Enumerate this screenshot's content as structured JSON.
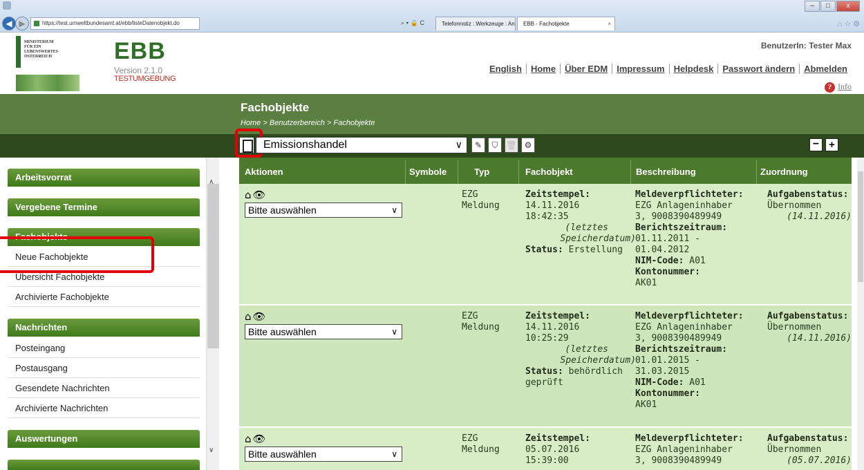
{
  "browser": {
    "url": "https://test.umweltbundesamt.at/ebb/listeDatenobjekt.do",
    "addr_tools": "⌕ ▾ 🔒 C",
    "tabs": [
      {
        "label": "Telefonnotiz : Werkzeuge : An..."
      },
      {
        "label": "EBB - Fachobjekte",
        "close": "×"
      }
    ]
  },
  "header": {
    "logo_text": "MINISTERIUM\nFÜR EIN\nLEBENSWERTES\nÖSTERREICH",
    "app_name": "EBB",
    "version": "Version 2.1.0",
    "environment": "TESTUMGEBUNG",
    "user": "BenutzerIn: Tester Max",
    "links": [
      "English",
      "Home",
      "Über EDM",
      "Impressum",
      "Helpdesk",
      "Passwort ändern",
      "Abmelden"
    ],
    "info": "Info",
    "info_icon": "?"
  },
  "page": {
    "title": "Fachobjekte",
    "breadcrumb": "Home > Benutzerbereich > Fachobjekte"
  },
  "toolbar": {
    "select_value": "Emissionshandel",
    "collapse": "−",
    "expand": "+"
  },
  "sidebar": {
    "sections": [
      {
        "title": "Arbeitsvorrat",
        "items": []
      },
      {
        "title": "Vergebene Termine",
        "items": []
      },
      {
        "title": "Fachobjekte",
        "items": [
          "Neue Fachobjekte",
          "Übersicht Fachobjekte",
          "Archivierte Fachobjekte"
        ]
      },
      {
        "title": "Nachrichten",
        "items": [
          "Posteingang",
          "Postausgang",
          "Gesendete Nachrichten",
          "Archivierte Nachrichten"
        ]
      },
      {
        "title": "Auswertungen",
        "items": []
      }
    ]
  },
  "table": {
    "columns": [
      "Aktionen",
      "Symbole",
      "Typ",
      "Fachobjekt",
      "Beschreibung",
      "Zuordnung"
    ],
    "rows": [
      {
        "action": "Bitte auswählen",
        "typ1": "EZG",
        "typ2": "Meldung",
        "ts_label": "Zeitstempel:",
        "date": "14.11.2016",
        "time": "18:42:35",
        "note1": "(letztes",
        "note2": "Speicherdatum)",
        "status_label": "Status:",
        "status": "Erstellung",
        "status2": "",
        "mv_label": "Meldeverpflichteter:",
        "mv1": "EZG Anlageninhaber",
        "mv2": "3, 9008390489949",
        "bz_label": "Berichtszeitraum:",
        "bz1": "01.11.2011 -",
        "bz2": "01.04.2012",
        "nim_label": "NIM-Code:",
        "nim": "A01",
        "konto_label": "Kontonummer:",
        "konto": "AK01",
        "zu_label": "Aufgabenstatus:",
        "zu_status": "Übernommen",
        "zu_date": "(14.11.2016)"
      },
      {
        "action": "Bitte auswählen",
        "typ1": "EZG",
        "typ2": "Meldung",
        "ts_label": "Zeitstempel:",
        "date": "14.11.2016",
        "time": "10:25:29",
        "note1": "(letztes",
        "note2": "Speicherdatum)",
        "status_label": "Status:",
        "status": "behördlich",
        "status2": "geprüft",
        "mv_label": "Meldeverpflichteter:",
        "mv1": "EZG Anlageninhaber",
        "mv2": "3, 9008390489949",
        "bz_label": "Berichtszeitraum:",
        "bz1": "01.01.2015 -",
        "bz2": "31.03.2015",
        "nim_label": "NIM-Code:",
        "nim": "A01",
        "konto_label": "Kontonummer:",
        "konto": "AK01",
        "zu_label": "Aufgabenstatus:",
        "zu_status": "Übernommen",
        "zu_date": "(14.11.2016)"
      },
      {
        "action": "Bitte auswählen",
        "typ1": "EZG",
        "typ2": "Meldung",
        "ts_label": "Zeitstempel:",
        "date": "05.07.2016",
        "time": "15:39:00",
        "mv_label": "Meldeverpflichteter:",
        "mv1": "EZG Anlageninhaber",
        "mv2": "3, 9008390489949",
        "zu_label": "Aufgabenstatus:",
        "zu_status": "Übernommen",
        "zu_date": "(05.07.2016)"
      }
    ]
  },
  "colors": {
    "header_green": "#5b7f43",
    "toolbar_dark": "#2e4a1c",
    "row_bg": "#d9ecc8",
    "highlight": "#e3000b"
  }
}
